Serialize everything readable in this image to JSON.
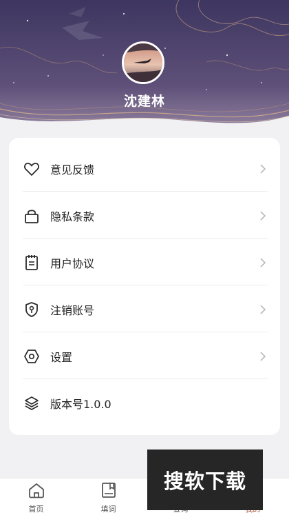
{
  "profile": {
    "username": "沈建林"
  },
  "menu": {
    "items": [
      {
        "label": "意见反馈",
        "icon": "heart-icon"
      },
      {
        "label": "隐私条款",
        "icon": "lock-icon"
      },
      {
        "label": "用户协议",
        "icon": "document-icon"
      },
      {
        "label": "注销账号",
        "icon": "shield-key-icon"
      },
      {
        "label": "设置",
        "icon": "gear-hexagon-icon"
      },
      {
        "label": "版本号1.0.0",
        "icon": "layers-icon"
      }
    ]
  },
  "tabbar": {
    "items": [
      {
        "label": "首页",
        "icon": "home-icon"
      },
      {
        "label": "填词",
        "icon": "notebook-icon"
      },
      {
        "label": "查询",
        "icon": "book-icon"
      },
      {
        "label": "我的",
        "icon": "profile-icon",
        "active": true
      }
    ]
  },
  "watermark": {
    "text": "搜软下载"
  },
  "colors": {
    "header_top": "#3d3660",
    "header_bottom": "#6a5b84",
    "accent": "#9b4a2a",
    "background": "#f1f1f3"
  }
}
